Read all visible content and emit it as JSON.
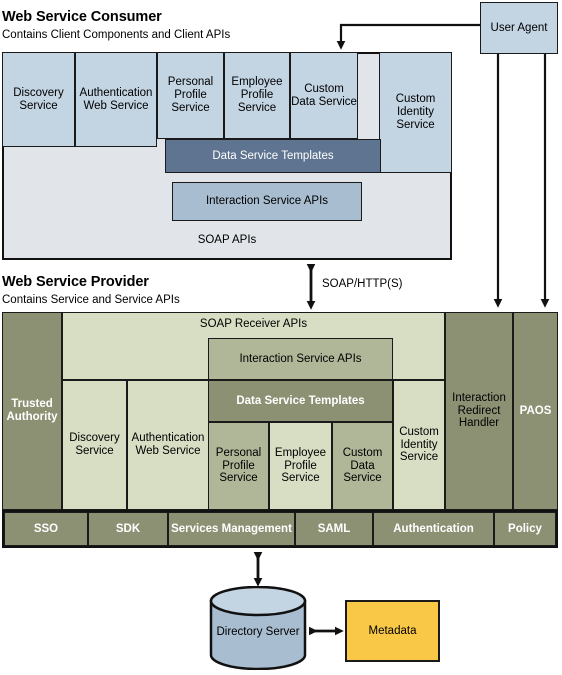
{
  "consumer": {
    "title": "Web Service Consumer",
    "subtitle": "Contains Client Components and Client APIs",
    "services": [
      {
        "label": "Discovery Service"
      },
      {
        "label": "Authentication Web Service"
      },
      {
        "label": "Personal Profile Service"
      },
      {
        "label": "Employee Profile Service"
      },
      {
        "label": "Custom Data Service"
      },
      {
        "label": "Custom Identity Service"
      }
    ],
    "data_service_templates": "Data Service Templates",
    "interaction_service_apis": "Interaction Service APIs",
    "soap_apis": "SOAP APIs"
  },
  "user_agent": {
    "label": "User Agent"
  },
  "connector": {
    "soap_http": "SOAP/HTTP(S)"
  },
  "provider": {
    "title": "Web Service Provider",
    "subtitle": "Contains Service and Service APIs",
    "trusted_authority": "Trusted Authority",
    "soap_receiver_apis": "SOAP Receiver APIs",
    "interaction_service_apis": "Interaction Service APIs",
    "data_service_templates": "Data Service Templates",
    "services": [
      {
        "label": "Discovery Service"
      },
      {
        "label": "Authentication Web Service"
      },
      {
        "label": "Personal Profile Service"
      },
      {
        "label": "Employee Profile Service"
      },
      {
        "label": "Custom Data Service"
      },
      {
        "label": "Custom Identity Service"
      }
    ],
    "interaction_redirect_handler": "Interaction Redirect Handler",
    "paos": "PAOS",
    "footer_items": [
      {
        "label": "SSO"
      },
      {
        "label": "SDK"
      },
      {
        "label": "Services Management"
      },
      {
        "label": "SAML"
      },
      {
        "label": "Authentication"
      },
      {
        "label": "Policy"
      }
    ]
  },
  "storage": {
    "directory_server": "Directory Server",
    "metadata": "Metadata"
  },
  "colors": {
    "consumer_light": "#c3d4e3",
    "consumer_mid": "#a8bdd0",
    "consumer_dark": "#5e7490",
    "consumer_pale": "#e1e5e9",
    "provider_olive": "#8c9174",
    "provider_pale": "#d8dec4",
    "provider_mid": "#b0b698",
    "metadata_yellow": "#f9c846",
    "stroke": "#111111"
  }
}
